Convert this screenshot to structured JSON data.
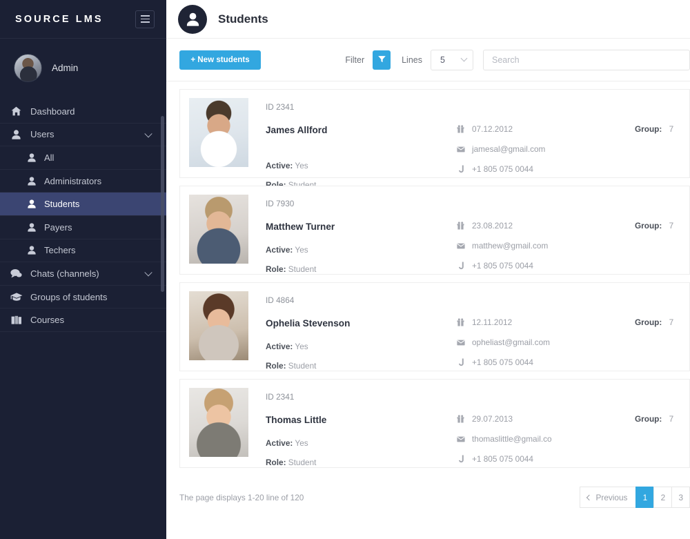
{
  "sidebar": {
    "brand": "SOURCE LMS",
    "menu_icon": "hamburger-icon",
    "user": {
      "name": "Admin",
      "avatar": "user-photo"
    },
    "items": [
      {
        "label": "Dashboard",
        "icon": "home-icon",
        "level": "top",
        "active": false,
        "expandable": false
      },
      {
        "label": "Users",
        "icon": "user-icon",
        "level": "top",
        "active": false,
        "expandable": true
      },
      {
        "label": "All",
        "icon": "user-icon",
        "level": "sub",
        "active": false,
        "expandable": false
      },
      {
        "label": "Administrators",
        "icon": "user-icon",
        "level": "sub",
        "active": false,
        "expandable": false
      },
      {
        "label": "Students",
        "icon": "user-icon",
        "level": "sub",
        "active": true,
        "expandable": false
      },
      {
        "label": "Payers",
        "icon": "user-icon",
        "level": "sub",
        "active": false,
        "expandable": false
      },
      {
        "label": "Techers",
        "icon": "user-icon",
        "level": "sub",
        "active": false,
        "expandable": false
      },
      {
        "label": "Chats (channels)",
        "icon": "chat-icon",
        "level": "top",
        "active": false,
        "expandable": true
      },
      {
        "label": "Groups of students",
        "icon": "graduation-cap-icon",
        "level": "top",
        "active": false,
        "expandable": false
      },
      {
        "label": "Courses",
        "icon": "books-icon",
        "level": "top",
        "active": false,
        "expandable": false
      }
    ]
  },
  "header": {
    "icon": "user-circle-icon",
    "title": "Students"
  },
  "toolbar": {
    "new_button": "+ New students",
    "filter_label": "Filter",
    "filter_icon": "funnel-icon",
    "lines_label": "Lines",
    "lines_value": "5",
    "search_placeholder": "Search"
  },
  "labels": {
    "active": "Active:",
    "role": "Role:",
    "group": "Group:",
    "birthday_icon": "gift-icon",
    "email_icon": "envelope-icon",
    "phone_icon": "phone-icon"
  },
  "students": [
    {
      "id": "ID 2341",
      "name": "James Allford",
      "active": "Yes",
      "role": "Student",
      "birthday": "07.12.2012",
      "email": "jamesal@gmail.com",
      "phone": "+1 805 075 0044",
      "group": "7",
      "photo": "t1"
    },
    {
      "id": "ID 7930",
      "name": "Matthew Turner",
      "active": "Yes",
      "role": "Student",
      "birthday": "23.08.2012",
      "email": "matthew@gmail.com",
      "phone": "+1 805 075 0044",
      "group": "7",
      "photo": "t2"
    },
    {
      "id": "ID 4864",
      "name": "Ophelia Stevenson",
      "active": "Yes",
      "role": "Student",
      "birthday": "12.11.2012",
      "email": "opheliast@gmail.com",
      "phone": "+1 805 075 0044",
      "group": "7",
      "photo": "t3"
    },
    {
      "id": "ID 2341",
      "name": "Thomas Little",
      "active": "Yes",
      "role": "Student",
      "birthday": "29.07.2013",
      "email": "thomaslittle@gmail.co",
      "phone": "+1 805 075 0044",
      "group": "7",
      "photo": "t4"
    }
  ],
  "pagination": {
    "info": "The page displays 1-20 line of 120",
    "previous": "Previous",
    "pages": [
      "1",
      "2",
      "3"
    ],
    "active_page": "1"
  },
  "colors": {
    "accent": "#32a7e0",
    "sidebar_bg": "#1b2034",
    "sidebar_active": "#3b4572"
  }
}
